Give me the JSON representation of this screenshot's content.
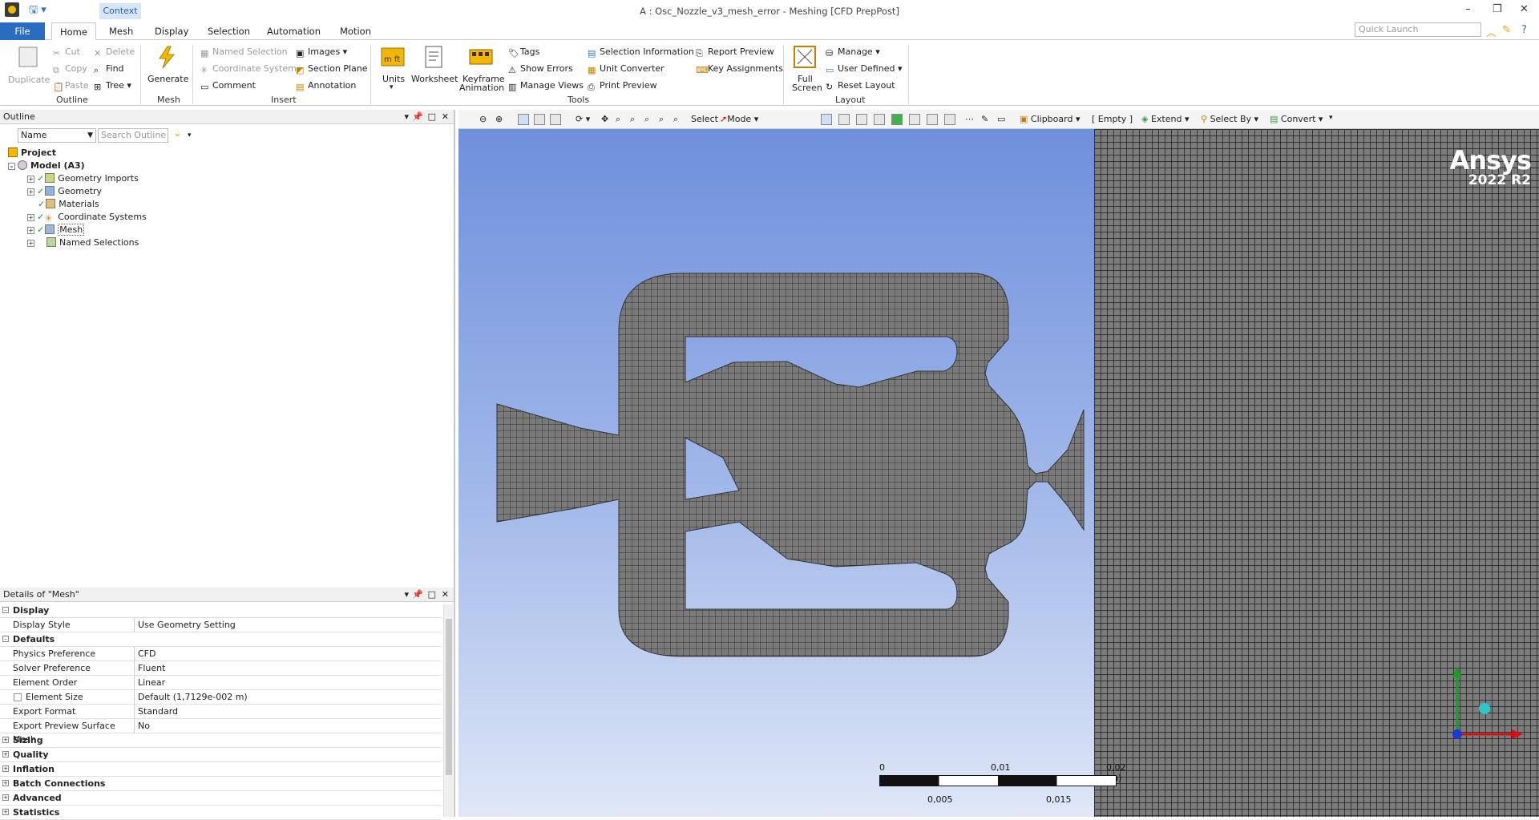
{
  "window": {
    "title": "A : Osc_Nozzle_v3_mesh_error - Meshing [CFD PrepPost]",
    "context_tab": "Context"
  },
  "tabs": [
    "File",
    "Home",
    "Mesh",
    "Display",
    "Selection",
    "Automation",
    "Motion"
  ],
  "quick_launch": {
    "placeholder": "Quick Launch"
  },
  "ribbon": {
    "outline": {
      "duplicate": "Duplicate",
      "cut": "Cut",
      "copy": "Copy",
      "paste": "Paste",
      "delete": "Delete",
      "find": "Find",
      "tree": "Tree",
      "group": "Outline"
    },
    "mesh": {
      "generate": "Generate",
      "group": "Mesh"
    },
    "insert": {
      "named_selection": "Named Selection",
      "coordinate_system": "Coordinate System",
      "comment": "Comment",
      "images": "Images",
      "section_plane": "Section Plane",
      "annotation": "Annotation",
      "group": "Insert"
    },
    "tools": {
      "units": "Units",
      "worksheet": "Worksheet",
      "keyframe": "Keyframe",
      "animation": "Animation",
      "tags": "Tags",
      "show_errors": "Show Errors",
      "manage_views": "Manage Views",
      "selection_information": "Selection Information",
      "unit_converter": "Unit Converter",
      "print_preview": "Print Preview",
      "report_preview": "Report Preview",
      "key_assignments": "Key Assignments",
      "group": "Tools"
    },
    "layout": {
      "full": "Full",
      "screen": "Screen",
      "manage": "Manage",
      "user_defined": "User Defined",
      "reset_layout": "Reset Layout",
      "group": "Layout"
    }
  },
  "outline": {
    "title": "Outline",
    "filter_name": "Name",
    "search_placeholder": "Search Outline",
    "tree": {
      "project": "Project",
      "model": "Model (A3)",
      "items": [
        "Geometry Imports",
        "Geometry",
        "Materials",
        "Coordinate Systems",
        "Mesh",
        "Named Selections"
      ]
    }
  },
  "details": {
    "title": "Details of \"Mesh\"",
    "rows": [
      {
        "section": "Display"
      },
      {
        "k": "Display Style",
        "v": "Use Geometry Setting"
      },
      {
        "section": "Defaults"
      },
      {
        "k": "Physics Preference",
        "v": "CFD"
      },
      {
        "k": "Solver Preference",
        "v": "Fluent"
      },
      {
        "k": "Element Order",
        "v": "Linear"
      },
      {
        "k": "Element Size",
        "v": "Default (1,7129e-002 m)"
      },
      {
        "k": "Export Format",
        "v": "Standard"
      },
      {
        "k": "Export Preview Surface Mesh",
        "v": "No"
      },
      {
        "section": "Sizing"
      },
      {
        "section": "Quality"
      },
      {
        "section": "Inflation"
      },
      {
        "section": "Batch Connections"
      },
      {
        "section": "Advanced"
      },
      {
        "section": "Statistics"
      }
    ]
  },
  "viewport_toolbar": {
    "select": "Select",
    "mode": "Mode",
    "clipboard": "Clipboard",
    "empty": "[ Empty ]",
    "extend": "Extend",
    "select_by": "Select By",
    "convert": "Convert"
  },
  "viewport": {
    "logo": "Ansys",
    "version": "2022 R2",
    "scale": {
      "top": [
        "0",
        "0,01",
        "0,02 (m)"
      ],
      "bottom": [
        "0,005",
        "0,015"
      ]
    }
  },
  "colors": {
    "accent": "#2a6dc0",
    "viewport_top": "#6e8fdc",
    "viewport_bottom": "#dfe7f7",
    "mesh": "#7c7c7c"
  }
}
